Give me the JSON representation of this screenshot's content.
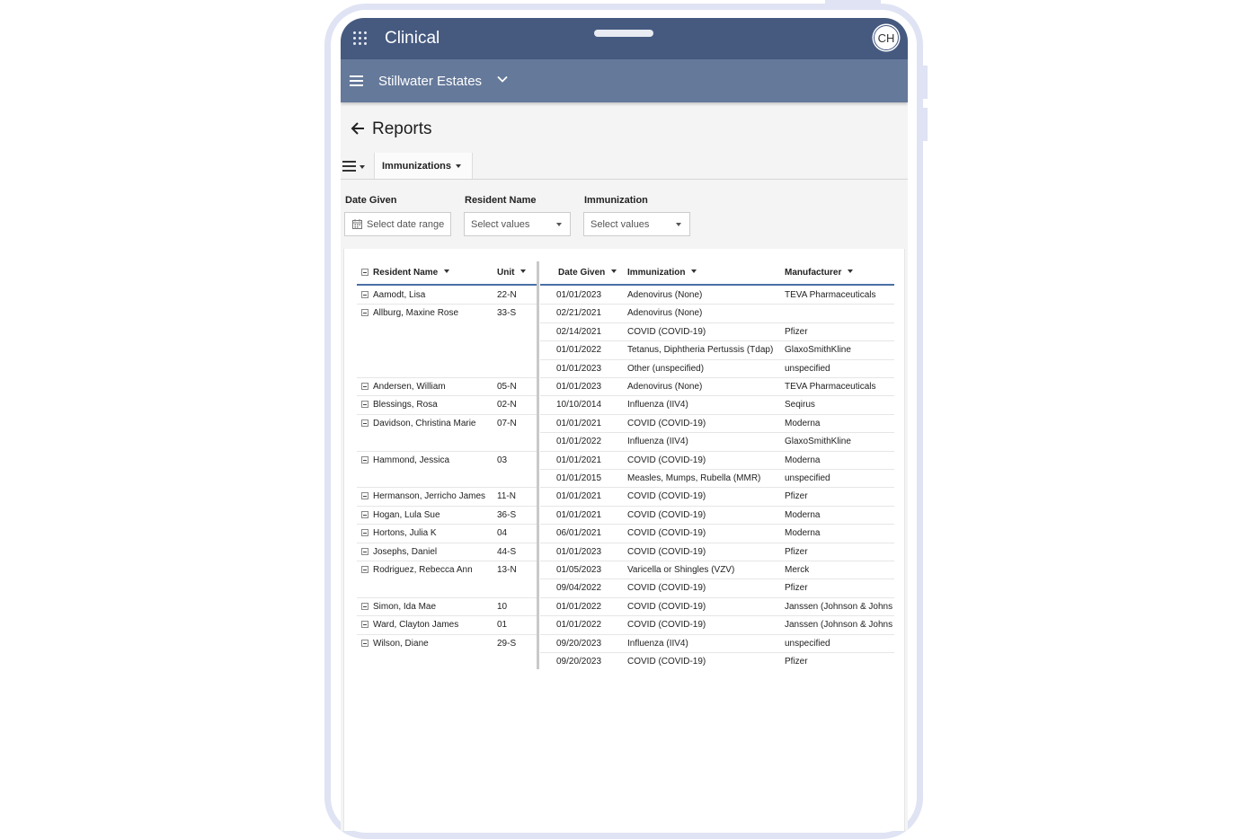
{
  "app": {
    "title": "Clinical",
    "avatar_initials": "CH"
  },
  "facility": {
    "name": "Stillwater Estates"
  },
  "page": {
    "title": "Reports"
  },
  "toolbar": {
    "report_tab": "Immunizations"
  },
  "filters": {
    "date_given": {
      "label": "Date Given",
      "placeholder": "Select date range"
    },
    "resident_name": {
      "label": "Resident Name",
      "placeholder": "Select values"
    },
    "immunization": {
      "label": "Immunization",
      "placeholder": "Select values"
    }
  },
  "table": {
    "columns": {
      "resident_name": "Resident Name",
      "unit": "Unit",
      "date_given": "Date Given",
      "immunization": "Immunization",
      "manufacturer": "Manufacturer"
    },
    "rows": [
      {
        "resident": "Aamodt, Lisa",
        "unit": "22-N",
        "date": "01/01/2023",
        "immunization": "Adenovirus (None)",
        "manufacturer": "TEVA Pharmaceuticals"
      },
      {
        "resident": "Allburg, Maxine Rose",
        "unit": "33-S",
        "date": "02/21/2021",
        "immunization": "Adenovirus (None)",
        "manufacturer": ""
      },
      {
        "resident": "",
        "unit": "",
        "date": "02/14/2021",
        "immunization": "COVID (COVID-19)",
        "manufacturer": "Pfizer"
      },
      {
        "resident": "",
        "unit": "",
        "date": "01/01/2022",
        "immunization": "Tetanus, Diphtheria Pertussis (Tdap)",
        "manufacturer": "GlaxoSmithKline"
      },
      {
        "resident": "",
        "unit": "",
        "date": "01/01/2023",
        "immunization": "Other (unspecified)",
        "manufacturer": "unspecified"
      },
      {
        "resident": "Andersen, William",
        "unit": "05-N",
        "date": "01/01/2023",
        "immunization": "Adenovirus (None)",
        "manufacturer": "TEVA Pharmaceuticals"
      },
      {
        "resident": "Blessings, Rosa",
        "unit": "02-N",
        "date": "10/10/2014",
        "immunization": "Influenza (IIV4)",
        "manufacturer": "Seqirus"
      },
      {
        "resident": "Davidson, Christina Marie",
        "unit": "07-N",
        "date": "01/01/2021",
        "immunization": "COVID (COVID-19)",
        "manufacturer": "Moderna"
      },
      {
        "resident": "",
        "unit": "",
        "date": "01/01/2022",
        "immunization": "Influenza (IIV4)",
        "manufacturer": "GlaxoSmithKline"
      },
      {
        "resident": "Hammond, Jessica",
        "unit": "03",
        "date": "01/01/2021",
        "immunization": "COVID (COVID-19)",
        "manufacturer": "Moderna"
      },
      {
        "resident": "",
        "unit": "",
        "date": "01/01/2015",
        "immunization": "Measles, Mumps, Rubella (MMR)",
        "manufacturer": "unspecified"
      },
      {
        "resident": "Hermanson, Jerricho James",
        "unit": "11-N",
        "date": "01/01/2021",
        "immunization": "COVID (COVID-19)",
        "manufacturer": "Pfizer"
      },
      {
        "resident": "Hogan, Lula Sue",
        "unit": "36-S",
        "date": "01/01/2021",
        "immunization": "COVID (COVID-19)",
        "manufacturer": "Moderna"
      },
      {
        "resident": "Hortons, Julia K",
        "unit": "04",
        "date": "06/01/2021",
        "immunization": "COVID (COVID-19)",
        "manufacturer": "Moderna"
      },
      {
        "resident": "Josephs, Daniel",
        "unit": "44-S",
        "date": "01/01/2023",
        "immunization": "COVID (COVID-19)",
        "manufacturer": "Pfizer"
      },
      {
        "resident": "Rodriguez, Rebecca Ann",
        "unit": "13-N",
        "date": "01/05/2023",
        "immunization": "Varicella or Shingles (VZV)",
        "manufacturer": "Merck"
      },
      {
        "resident": "",
        "unit": "",
        "date": "09/04/2022",
        "immunization": "COVID (COVID-19)",
        "manufacturer": "Pfizer"
      },
      {
        "resident": "Simon, Ida Mae",
        "unit": "10",
        "date": "01/01/2022",
        "immunization": "COVID (COVID-19)",
        "manufacturer": "Janssen (Johnson & Johns"
      },
      {
        "resident": "Ward, Clayton James",
        "unit": "01",
        "date": "01/01/2022",
        "immunization": "COVID (COVID-19)",
        "manufacturer": "Janssen (Johnson & Johns"
      },
      {
        "resident": "Wilson, Diane",
        "unit": "29-S",
        "date": "09/20/2023",
        "immunization": "Influenza (IIV4)",
        "manufacturer": "unspecified"
      },
      {
        "resident": "",
        "unit": "",
        "date": "09/20/2023",
        "immunization": "COVID (COVID-19)",
        "manufacturer": "Pfizer"
      }
    ]
  }
}
